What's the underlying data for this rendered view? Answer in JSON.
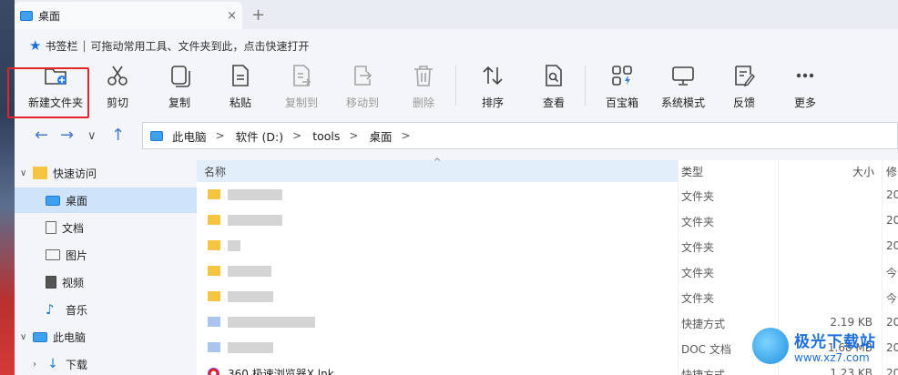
{
  "window": {
    "tab_title": "桌面",
    "tab_close": "×",
    "tab_add": "+"
  },
  "bookmark_bar": {
    "label": "书签栏",
    "separator": "|",
    "hint": "可拖动常用工具、文件夹到此，点击快速打开"
  },
  "toolbar": {
    "new_folder": "新建文件夹",
    "cut": "剪切",
    "copy": "复制",
    "paste": "粘贴",
    "copy_to": "复制到",
    "move_to": "移动到",
    "delete": "删除",
    "sort": "排序",
    "view": "查看",
    "toolbox": "百宝箱",
    "system_mode": "系统模式",
    "feedback": "反馈",
    "more": "更多"
  },
  "address_bar": {
    "crumbs": [
      "此电脑",
      "软件 (D:)",
      "tools",
      "桌面"
    ],
    "separator": ">"
  },
  "sidebar": {
    "items": [
      {
        "label": "快速访问"
      },
      {
        "label": "桌面"
      },
      {
        "label": "文档"
      },
      {
        "label": "图片"
      },
      {
        "label": "视频"
      },
      {
        "label": "音乐"
      },
      {
        "label": "此电脑"
      },
      {
        "label": "下载"
      }
    ]
  },
  "file_list": {
    "headers": {
      "name": "名称",
      "type": "类型",
      "size": "大小",
      "modified": "修"
    },
    "rows": [
      {
        "type": "文件夹",
        "size": "",
        "modified": "20"
      },
      {
        "type": "文件夹",
        "size": "",
        "modified": "20"
      },
      {
        "type": "文件夹",
        "size": "",
        "modified": "20"
      },
      {
        "type": "文件夹",
        "size": "",
        "modified": "今"
      },
      {
        "type": "文件夹",
        "size": "",
        "modified": "今"
      },
      {
        "type": "快捷方式",
        "size": "2.19 KB",
        "modified": "20"
      },
      {
        "type": "DOC 文档",
        "size": "1.68 MB",
        "modified": "20"
      },
      {
        "name": "360 极速浏览器X.lnk",
        "type": "快捷方式",
        "size": "1.23 KB",
        "modified": "20"
      }
    ]
  },
  "watermark": {
    "title": "极光下载站",
    "url": "www.xz7.com"
  },
  "colors": {
    "accent": "#1e6fd9",
    "highlight_box": "#e2242a",
    "selected_row": "#cfe3fb",
    "folder": "#f5c542"
  }
}
